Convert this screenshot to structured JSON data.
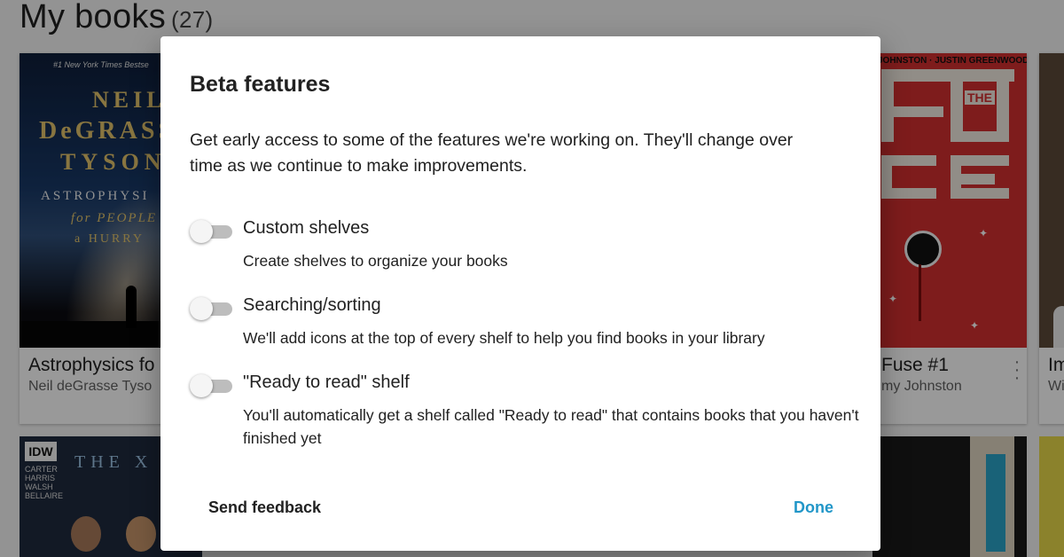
{
  "page": {
    "title": "My books",
    "count": "(27)"
  },
  "books": [
    {
      "title": "Astrophysics fo",
      "author": "Neil deGrasse Tyso",
      "cover": {
        "blurb": "#1 New York Times Bestse",
        "line1": "NEIL",
        "line2": "DeGRASS",
        "line3": "TYSON",
        "line4": "ASTROPHYSI",
        "line5": "for PEOPLE i",
        "line6": "a HURRY"
      }
    },
    {
      "title": "Fuse #1",
      "author": "my Johnston",
      "cover": {
        "credits": "JOHNSTON · JUSTIN GREENWOOD",
        "the": "THE"
      }
    },
    {
      "title": "Im",
      "author": "Wi"
    },
    {
      "cover": {
        "publisher": "IDW",
        "names": [
          "CARTER",
          "HARRIS",
          "WALSH",
          "BELLAIRE"
        ],
        "title_fragment": "THE X FI"
      }
    }
  ],
  "dialog": {
    "title": "Beta features",
    "description": "Get early access to some of the features we're working on. They'll change over time as we continue to make improvements.",
    "features": [
      {
        "name": "Custom shelves",
        "description": "Create shelves to organize your books",
        "enabled": false
      },
      {
        "name": "Searching/sorting",
        "description": "We'll add icons at the top of every shelf to help you find books in your library",
        "enabled": false
      },
      {
        "name": "\"Ready to read\" shelf",
        "description": "You'll automatically get a shelf called \"Ready to read\" that contains books that you haven't finished yet",
        "enabled": false
      }
    ],
    "feedback_label": "Send feedback",
    "done_label": "Done"
  },
  "colors": {
    "accent": "#2196c8",
    "toggle_track_off": "#bdbdbd"
  }
}
